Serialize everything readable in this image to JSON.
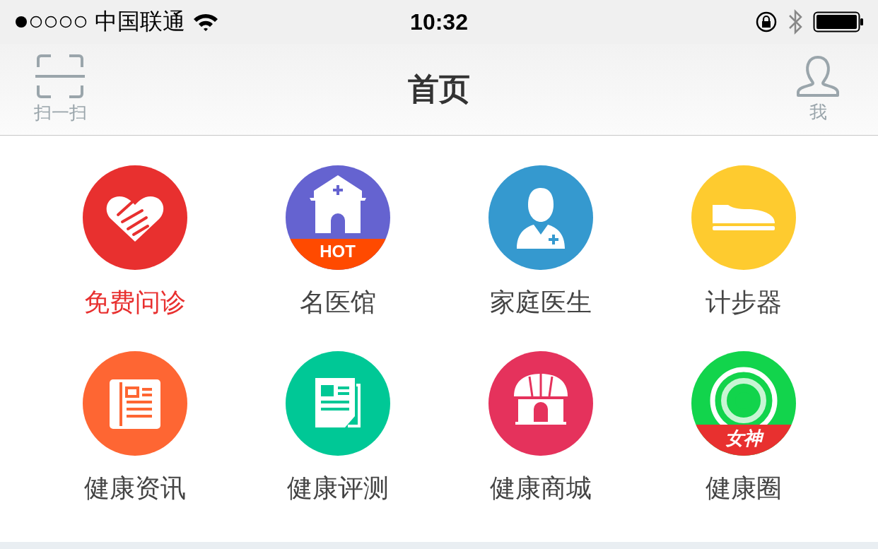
{
  "status_bar": {
    "carrier": "中国联通",
    "time": "10:32"
  },
  "nav_bar": {
    "left_button": {
      "label": "扫一扫"
    },
    "title": "首页",
    "right_button": {
      "label": "我"
    }
  },
  "features": [
    {
      "label": "免费问诊",
      "kind": "heart",
      "color": "#e8302f",
      "selected": true
    },
    {
      "label": "名医馆",
      "kind": "house",
      "color": "#6563d0",
      "selected": false,
      "badge": {
        "text": "HOT",
        "color": "#ff4a00"
      }
    },
    {
      "label": "家庭医生",
      "kind": "doctor",
      "color": "#3599cf",
      "selected": false
    },
    {
      "label": "计步器",
      "kind": "shoe",
      "color": "#fecb2f",
      "selected": false
    },
    {
      "label": "健康资讯",
      "kind": "newspaper",
      "color": "#fe6633",
      "selected": false
    },
    {
      "label": "健康评测",
      "kind": "document",
      "color": "#00c896",
      "selected": false
    },
    {
      "label": "健康商城",
      "kind": "shop",
      "color": "#e5325c",
      "selected": false
    },
    {
      "label": "健康圈",
      "kind": "target",
      "color": "#12d44c",
      "selected": false,
      "badge": {
        "text": "女神",
        "color": "#e8302f"
      }
    }
  ]
}
